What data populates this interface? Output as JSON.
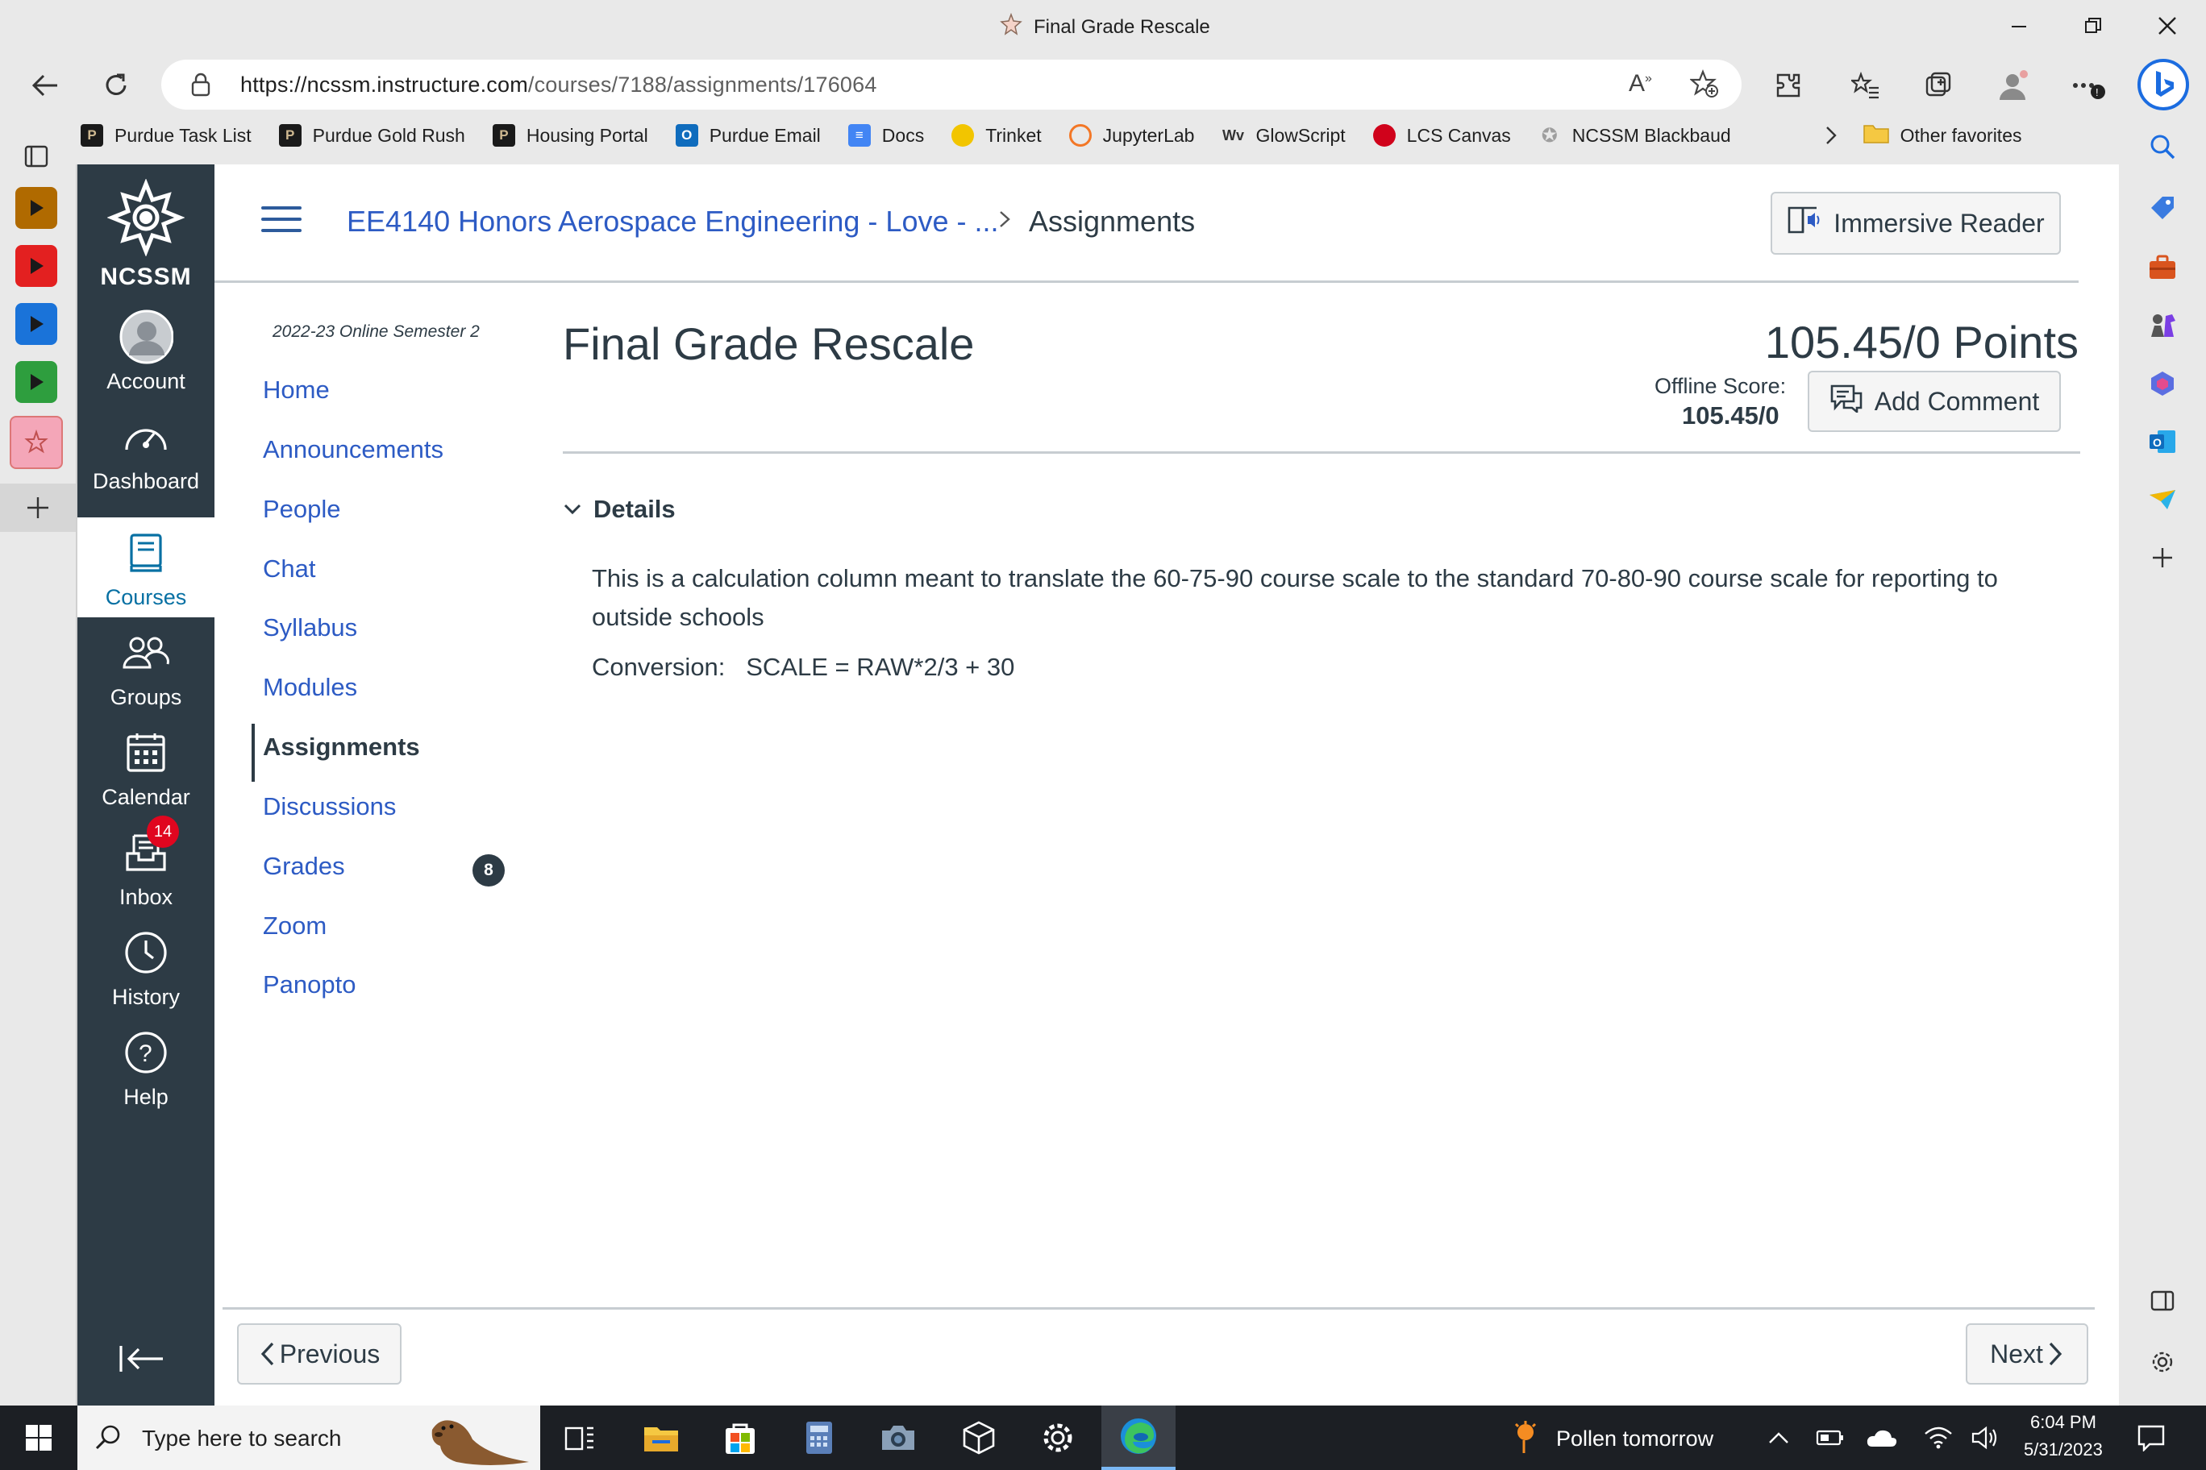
{
  "browser": {
    "tab_title": "Final Grade Rescale",
    "url_host": "https://ncssm.instructure.com",
    "url_path": "/courses/7188/assignments/176064"
  },
  "favorites": [
    {
      "label": "Purdue Task List",
      "icon": "purdue-icon",
      "color": "#cfb991"
    },
    {
      "label": "Purdue Gold Rush",
      "icon": "purdue-icon",
      "color": "#cfb991"
    },
    {
      "label": "Housing Portal",
      "icon": "purdue-icon",
      "color": "#cfb991"
    },
    {
      "label": "Purdue Email",
      "icon": "outlook-icon",
      "color": "#0f6cbd"
    },
    {
      "label": "Docs",
      "icon": "docs-icon",
      "color": "#4285f4"
    },
    {
      "label": "Trinket",
      "icon": "trinket-icon",
      "color": "#f2c500"
    },
    {
      "label": "JupyterLab",
      "icon": "jupyter-icon",
      "color": "#f37726"
    },
    {
      "label": "GlowScript",
      "icon": "glowscript-icon",
      "color": "#333333"
    },
    {
      "label": "LCS Canvas",
      "icon": "apple-icon",
      "color": "#d0021b"
    },
    {
      "label": "NCSSM Blackbaud",
      "icon": "ncssm-star-icon",
      "color": "#9e9e9e"
    }
  ],
  "favorites_other": "Other favorites",
  "global_nav": {
    "brand": "NCSSM",
    "items": [
      {
        "label": "Account",
        "icon": "account-icon"
      },
      {
        "label": "Dashboard",
        "icon": "dashboard-icon"
      },
      {
        "label": "Courses",
        "icon": "courses-icon"
      },
      {
        "label": "Groups",
        "icon": "groups-icon"
      },
      {
        "label": "Calendar",
        "icon": "calendar-icon"
      },
      {
        "label": "Inbox",
        "icon": "inbox-icon",
        "badge": "14"
      },
      {
        "label": "History",
        "icon": "history-icon"
      },
      {
        "label": "Help",
        "icon": "help-icon"
      }
    ]
  },
  "breadcrumb": {
    "course": "EE4140 Honors Aerospace Engineering - Love - ...",
    "separator": ">",
    "current": "Assignments"
  },
  "immersive_reader_label": "Immersive Reader",
  "course_nav": {
    "term": "2022-23 Online Semester 2",
    "items": [
      "Home",
      "Announcements",
      "People",
      "Chat",
      "Syllabus",
      "Modules",
      "Assignments",
      "Discussions",
      "Grades",
      "Zoom",
      "Panopto"
    ],
    "active": "Assignments",
    "grades_badge": "8"
  },
  "assignment": {
    "title": "Final Grade Rescale",
    "points_value": "105.45/0",
    "points_unit": "Points",
    "offline_label": "Offline Score:",
    "offline_value": "105.45/0",
    "add_comment_label": "Add Comment",
    "details_label": "Details",
    "description": "This is a calculation column meant to translate the 60-75-90 course scale to the standard 70-80-90 course scale for reporting to outside schools",
    "conversion": "Conversion:   SCALE = RAW*2/3 + 30"
  },
  "footer": {
    "previous_label": "Previous",
    "next_label": "Next"
  },
  "taskbar": {
    "search_placeholder": "Type here to search",
    "weather": "Pollen tomorrow",
    "time": "6:04 PM",
    "date": "5/31/2023"
  },
  "colors": {
    "canvas_nav": "#2d3b45",
    "link": "#2d5bc4",
    "badge_red": "#e0061f"
  }
}
